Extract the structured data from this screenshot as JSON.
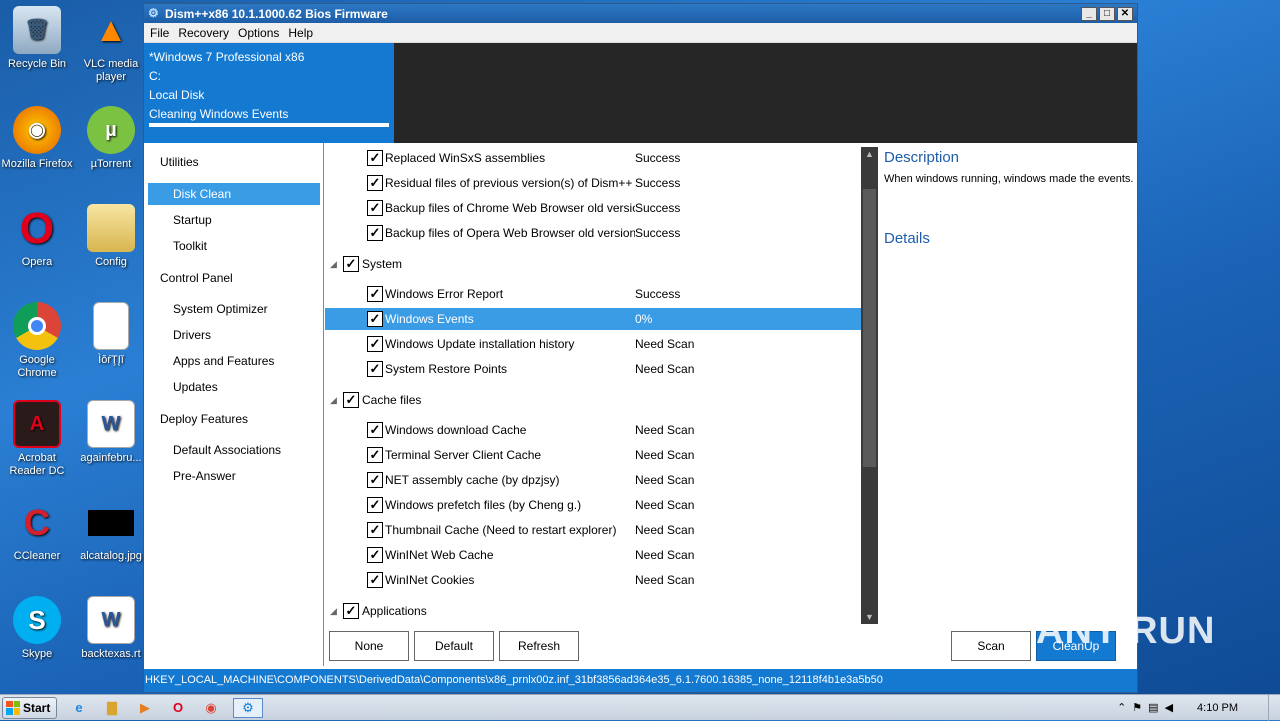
{
  "desktop": {
    "icons": [
      {
        "label": "Recycle Bin"
      },
      {
        "label": "VLC media player"
      },
      {
        "label": "Mozilla Firefox"
      },
      {
        "label": "µTorrent"
      },
      {
        "label": "Opera"
      },
      {
        "label": "Config"
      },
      {
        "label": "Google Chrome"
      },
      {
        "label": "ÌŏŕŢĮĭ"
      },
      {
        "label": "Acrobat Reader DC"
      },
      {
        "label": "againfebru..."
      },
      {
        "label": "CCleaner"
      },
      {
        "label": "alcatalog.jpg"
      },
      {
        "label": "Skype"
      },
      {
        "label": "backtexas.rt"
      }
    ]
  },
  "window": {
    "title": "Dism++x86 10.1.1000.62 Bios Firmware",
    "buttons": {
      "minimize": "_",
      "maximize": "□",
      "close": "✕"
    },
    "menu": [
      "File",
      "Recovery",
      "Options",
      "Help"
    ],
    "header": {
      "lines": [
        "*Windows 7 Professional x86",
        "C:",
        "Local Disk",
        "Cleaning Windows Events"
      ]
    },
    "sidebar": [
      {
        "label": "Utilities",
        "level": "top"
      },
      {
        "label": "Disk Clean",
        "level": "sub",
        "active": true
      },
      {
        "label": "Startup",
        "level": "sub"
      },
      {
        "label": "Toolkit",
        "level": "sub"
      },
      {
        "label": "Control Panel",
        "level": "top"
      },
      {
        "label": "System Optimizer",
        "level": "sub"
      },
      {
        "label": "Drivers",
        "level": "sub"
      },
      {
        "label": "Apps and Features",
        "level": "sub"
      },
      {
        "label": "Updates",
        "level": "sub"
      },
      {
        "label": "Deploy Features",
        "level": "top"
      },
      {
        "label": "Default Associations",
        "level": "sub"
      },
      {
        "label": "Pre-Answer",
        "level": "sub"
      }
    ],
    "list": [
      {
        "type": "item",
        "name": "Replaced WinSxS assemblies",
        "status": "Success"
      },
      {
        "type": "item",
        "name": "Residual files of previous version(s) of Dism++",
        "status": "Success"
      },
      {
        "type": "item",
        "name": "Backup files of Chrome Web Browser old versio",
        "status": "Success"
      },
      {
        "type": "item",
        "name": "Backup files of Opera Web Browser old version i",
        "status": "Success"
      },
      {
        "type": "group",
        "name": "System"
      },
      {
        "type": "item",
        "name": "Windows Error Report",
        "status": "Success"
      },
      {
        "type": "item",
        "name": "Windows Events",
        "status": "0%",
        "selected": true
      },
      {
        "type": "item",
        "name": "Windows Update installation history",
        "status": "Need Scan"
      },
      {
        "type": "item",
        "name": "System Restore Points",
        "status": "Need Scan"
      },
      {
        "type": "group",
        "name": "Cache files"
      },
      {
        "type": "item",
        "name": "Windows download Cache",
        "status": "Need Scan"
      },
      {
        "type": "item",
        "name": "Terminal Server Client Cache",
        "status": "Need Scan"
      },
      {
        "type": "item",
        "name": "NET assembly cache (by dpzjsy)",
        "status": "Need Scan"
      },
      {
        "type": "item",
        "name": "Windows prefetch files (by Cheng g.)",
        "status": "Need Scan"
      },
      {
        "type": "item",
        "name": "Thumbnail Cache (Need to restart explorer)",
        "status": "Need Scan"
      },
      {
        "type": "item",
        "name": "WinINet Web Cache",
        "status": "Need Scan"
      },
      {
        "type": "item",
        "name": "WinINet Cookies",
        "status": "Need Scan"
      },
      {
        "type": "group",
        "name": "Applications"
      }
    ],
    "description": {
      "title": "Description",
      "text": "When windows running, windows made the events.",
      "details_title": "Details"
    },
    "buttons_bottom": {
      "none": "None",
      "default": "Default",
      "refresh": "Refresh",
      "scan": "Scan",
      "cleanup": "CleanUp"
    },
    "statusbar": "HKEY_LOCAL_MACHINE\\COMPONENTS\\DerivedData\\Components\\x86_prnlx00z.inf_31bf3856ad364e35_6.1.7600.16385_none_12118f4b1e3a5b50"
  },
  "taskbar": {
    "start_label": "Start",
    "clock": "4:10 PM"
  },
  "watermark": "ANY RUN"
}
